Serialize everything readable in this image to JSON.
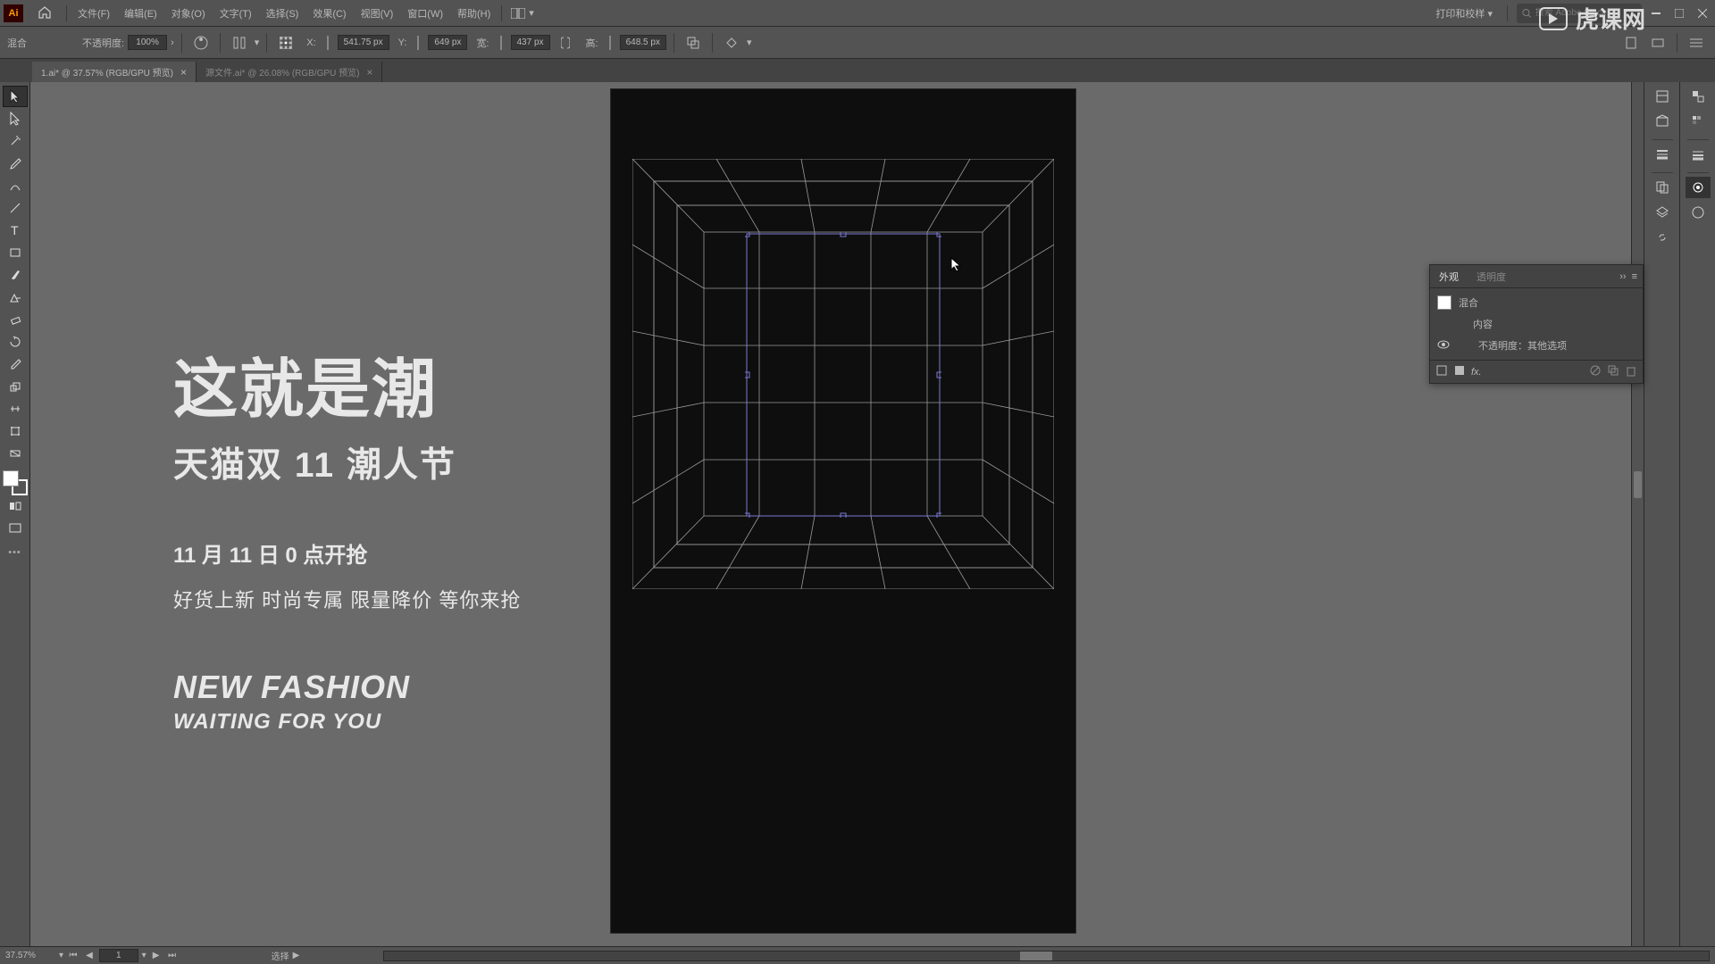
{
  "menu": {
    "items": [
      "文件(F)",
      "编辑(E)",
      "对象(O)",
      "文字(T)",
      "选择(S)",
      "效果(C)",
      "视图(V)",
      "窗口(W)",
      "帮助(H)"
    ],
    "workspace": "打印和校样",
    "search_placeholder": "搜索 Adobe Stock"
  },
  "control": {
    "mode": "混合",
    "opacity_label": "不透明度:",
    "opacity_value": "100%",
    "x_label": "X:",
    "x_value": "541.75 px",
    "y_label": "Y:",
    "y_value": "649 px",
    "w_label": "宽:",
    "w_value": "437 px",
    "h_label": "高:",
    "h_value": "648.5 px"
  },
  "tabs": {
    "active": "1.ai* @ 37.57% (RGB/GPU 预览)",
    "inactive": "源文件.ai* @ 26.08% (RGB/GPU 预览)"
  },
  "canvas_text": {
    "h1": "这就是潮",
    "h2": "天猫双 11 潮人节",
    "h3": "11 月 11 日 0 点开抢",
    "h4": "好货上新 时尚专属 限量降价 等你来抢",
    "h5": "NEW FASHION",
    "h6": "WAITING FOR YOU"
  },
  "panel": {
    "tab1": "外观",
    "tab2": "透明度",
    "row1": "混合",
    "row2": "内容",
    "row3": "不透明度：其他选项",
    "fx": "fx."
  },
  "status": {
    "zoom": "37.57%",
    "artboard": "1",
    "tool": "选择"
  },
  "watermark": "虎课网"
}
